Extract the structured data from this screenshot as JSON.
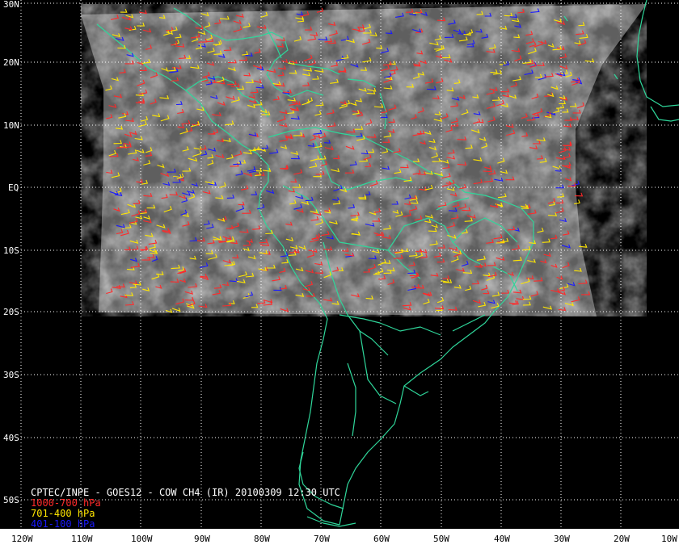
{
  "title": "CPTEC/INPE - GOES12 - COW CH4 (IR) 20100309 12:30 UTC",
  "legend": [
    {
      "label": "1000-700 hPa",
      "color": "#ff2a2a"
    },
    {
      "label": "701-400 hPa",
      "color": "#ffe600"
    },
    {
      "label": "401-100 hPa",
      "color": "#1a1aff"
    }
  ],
  "lat_labels": [
    "30N",
    "20N",
    "10N",
    "EQ",
    "10S",
    "20S",
    "30S",
    "40S",
    "50S"
  ],
  "lon_labels": [
    "120W",
    "110W",
    "100W",
    "90W",
    "80W",
    "70W",
    "60W",
    "50W",
    "40W",
    "30W",
    "20W",
    "10W"
  ],
  "colors": {
    "background": "#000000",
    "coastline": "#2fd69a",
    "grid": "#ffffff",
    "ir_image": "#6a6a6a"
  }
}
